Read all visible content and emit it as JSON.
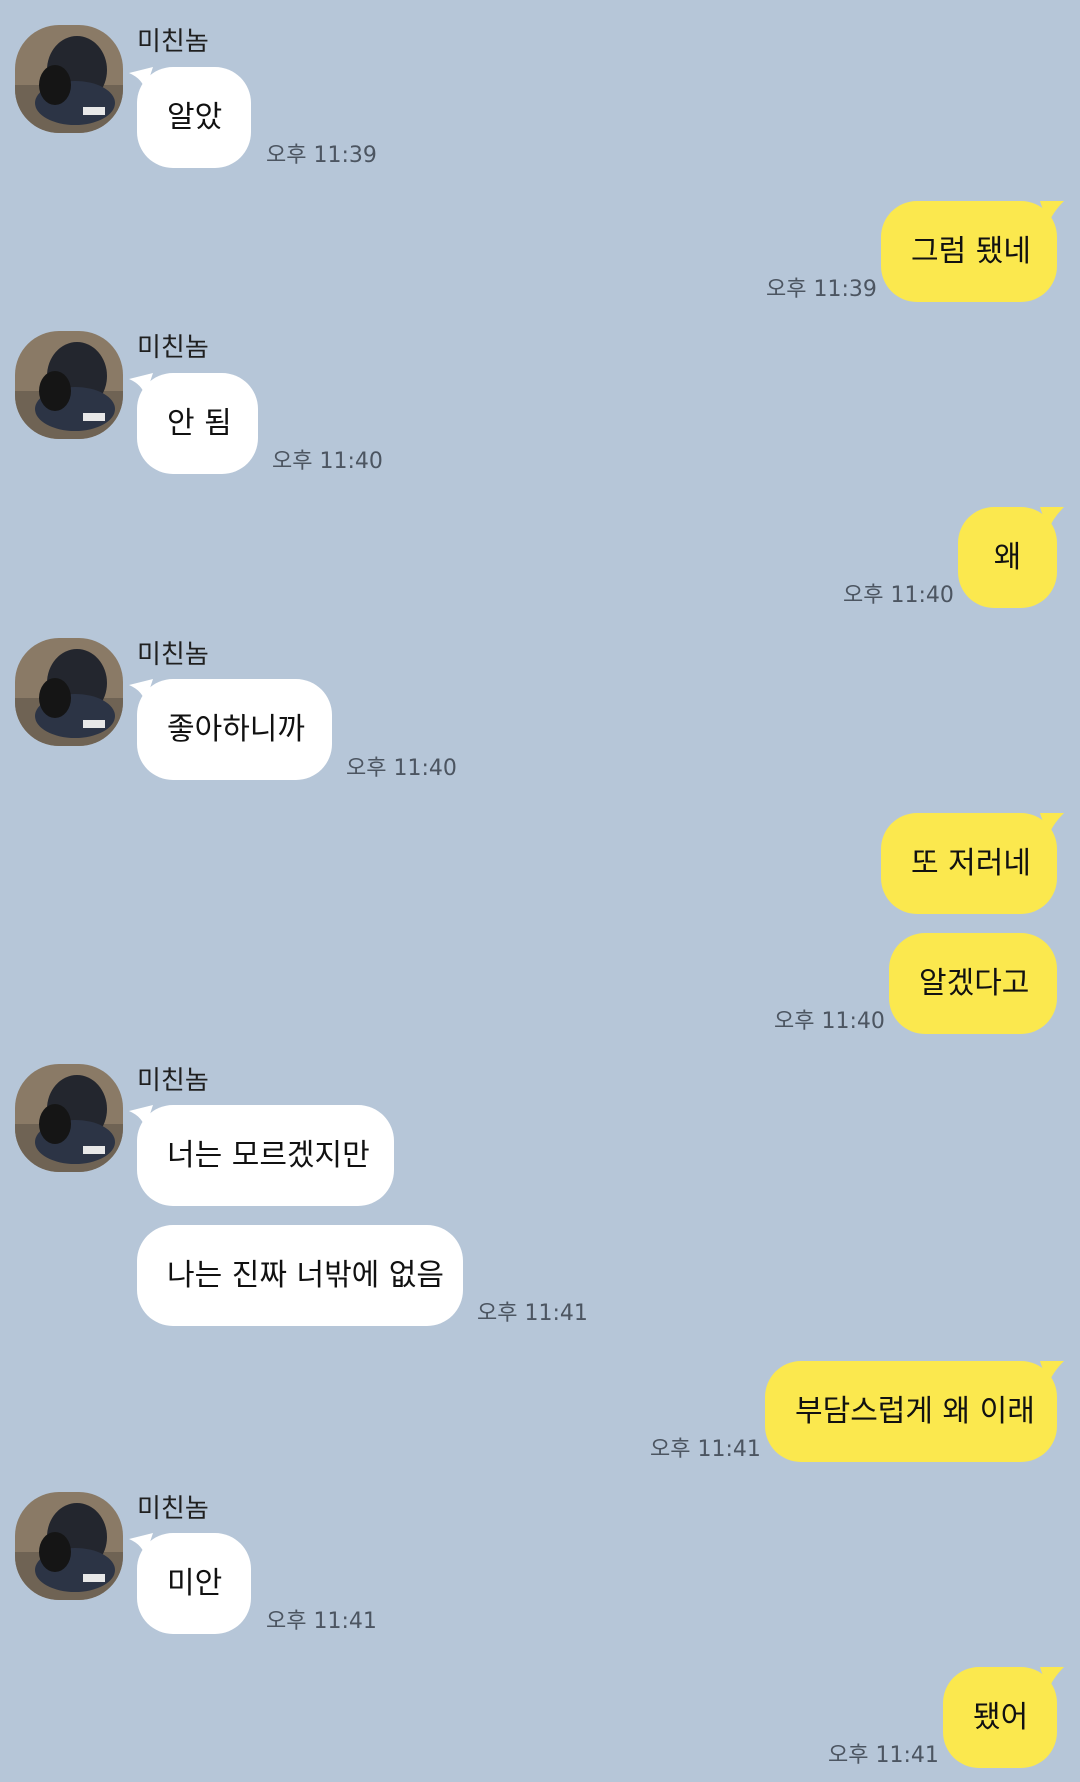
{
  "sender_name": "미친놈",
  "messages": [
    {
      "side": "in",
      "text": "알았",
      "time": "오후 11:39"
    },
    {
      "side": "out",
      "text": "그럼 됐네",
      "time": "오후 11:39"
    },
    {
      "side": "in",
      "text": "안 됨",
      "time": "오후 11:40"
    },
    {
      "side": "out",
      "text": "왜",
      "time": "오후 11:40"
    },
    {
      "side": "in",
      "text": "좋아하니까",
      "time": "오후 11:40"
    },
    {
      "side": "out",
      "text": "또 저러네",
      "time": ""
    },
    {
      "side": "out",
      "text": "알겠다고",
      "time": "오후 11:40"
    },
    {
      "side": "in",
      "text": "너는 모르겠지만",
      "time": ""
    },
    {
      "side": "in",
      "text": "나는 진짜 너밖에 없음",
      "time": "오후 11:41"
    },
    {
      "side": "out",
      "text": "부담스럽게 왜 이래",
      "time": "오후 11:41"
    },
    {
      "side": "in",
      "text": "미안",
      "time": "오후 11:41"
    },
    {
      "side": "out",
      "text": "됐어",
      "time": "오후 11:41"
    }
  ],
  "colors": {
    "background": "#b6c6d8",
    "incoming_bubble": "#ffffff",
    "outgoing_bubble": "#fbe84e"
  },
  "icons": {
    "avatar": "profile-photo-avatar"
  }
}
